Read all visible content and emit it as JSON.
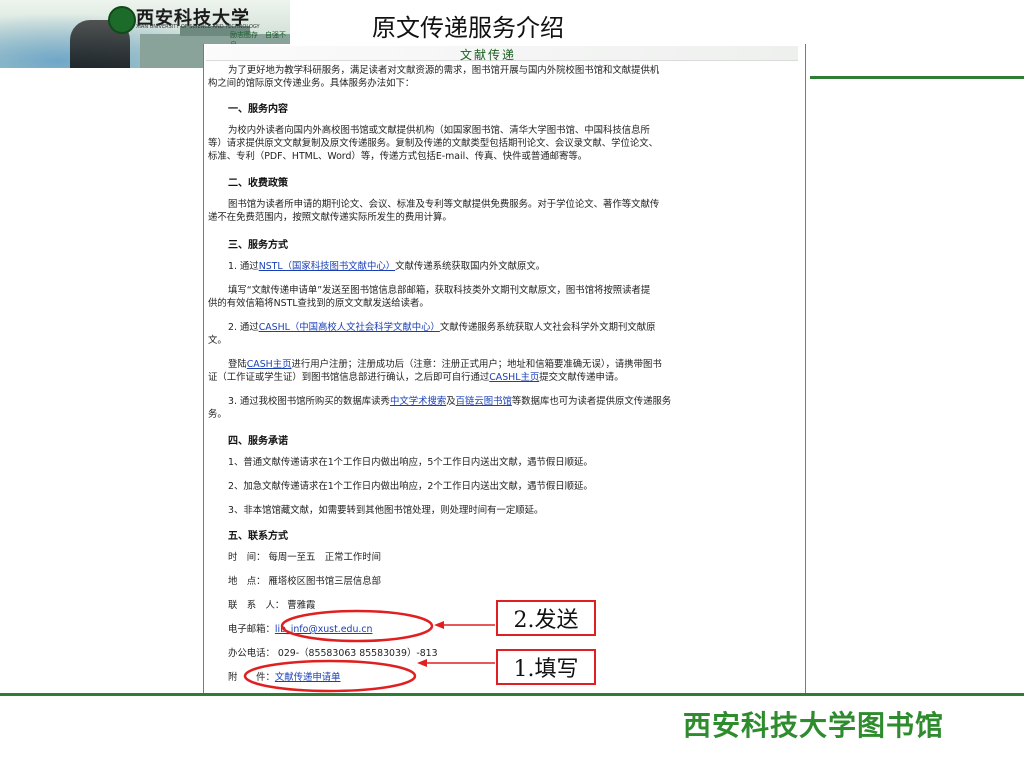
{
  "header": {
    "university_name": "西安科技大学",
    "university_en": "XIAN UNIVERSITY OF SCIENCE AND TECHNOLOGY",
    "motto": "励志图存　自强不息",
    "slide_title": "原文传递服务介绍"
  },
  "doc": {
    "banner_title": "文献传递",
    "intro_1": "为了更好地为教学科研服务，满足读者对文献资源的需求，图书馆开展与国内外院校图书馆和文献提供机",
    "intro_2": "构之间的馆际原文传递业务。具体服务办法如下：",
    "s1_title": "一、服务内容",
    "s1_l1": "为校内外读者向国内外高校图书馆或文献提供机构（如国家图书馆、清华大学图书馆、中国科技信息所",
    "s1_l2": "等）请求提供原文文献复制及原文传递服务。复制及传递的文献类型包括期刊论文、会议录文献、学位论文、",
    "s1_l3": "标准、专利（PDF、HTML、Word）等，传递方式包括E-mail、传真、快件或普通邮寄等。",
    "s2_title": "二、收费政策",
    "s2_l1": "图书馆为读者所申请的期刊论文、会议、标准及专利等文献提供免费服务。对于学位论文、著作等文献传",
    "s2_l2": "递不在免费范围内，按照文献传递实际所发生的费用计算。",
    "s3_title": "三、服务方式",
    "s3_p1_a": "1. 通过",
    "s3_p1_link": "NSTL（国家科技图书文献中心）",
    "s3_p1_b": "文献传递系统获取国内外文献原文。",
    "s3_p2_l1": "填写“文献传递申请单”发送至图书馆信息部邮箱，获取科技类外文期刊文献原文，图书馆将按照读者提",
    "s3_p2_l2": "供的有效信箱将NSTL查找到的原文文献发送给读者。",
    "s3_p3_a": "2. 通过",
    "s3_p3_link": "CASHL（中国高校人文社会科学文献中心）",
    "s3_p3_b": "文献传递服务系统获取人文社会科学外文期刊文献原",
    "s3_p3_l2": "文。",
    "s3_p4_a": "登陆",
    "s3_p4_link1": "CASH主页",
    "s3_p4_b": "进行用户注册；注册成功后（注意：注册正式用户；地址和信箱要准确无误），请携带图书",
    "s3_p4_l2_a": "证（工作证或学生证）到图书馆信息部进行确认，之后即可自行通过",
    "s3_p4_link2": "CASHL主页",
    "s3_p4_l2_b": "提交文献传递申请。",
    "s3_p5_a": "3. 通过我校图书馆所购买的数据库读秀",
    "s3_p5_link1": "中文学术搜索",
    "s3_p5_b": "及",
    "s3_p5_link2": "百链云图书馆",
    "s3_p5_c": "等数据库也可为读者提供原文传递服务",
    "s3_p5_l2": "务。",
    "s4_title": "四、服务承诺",
    "s4_l1": "1、普通文献传递请求在1个工作日内做出响应，5个工作日内送出文献，遇节假日顺延。",
    "s4_l2": "2、加急文献传递请求在1个工作日内做出响应，2个工作日内送出文献，遇节假日顺延。",
    "s4_l3": "3、非本馆馆藏文献，如需要转到其他图书馆处理，则处理时间有一定顺延。",
    "s5_title": "五、联系方式",
    "time_label": "时　间：",
    "time_value": "每周一至五　正常工作时间",
    "place_label": "地　点：",
    "place_value": "雁塔校区图书馆三层信息部",
    "contact_label": "联　系　人：",
    "contact_value": "曹雅霞",
    "email_label": "电子邮箱：",
    "email_value": "lib_info@xust.edu.cn",
    "phone_label": "办公电话：",
    "phone_value": "029-（85583063 85583039）-813",
    "attach_label": "附　　件：",
    "attach_link": "文献传递申请单"
  },
  "callouts": {
    "send": "2.发送",
    "fill": "1.填写"
  },
  "footer": {
    "library_name": "西安科技大学图书馆"
  },
  "colors": {
    "accent_green": "#2e7d32",
    "callout_red": "#e02020",
    "link_blue": "#1a3fb4"
  }
}
